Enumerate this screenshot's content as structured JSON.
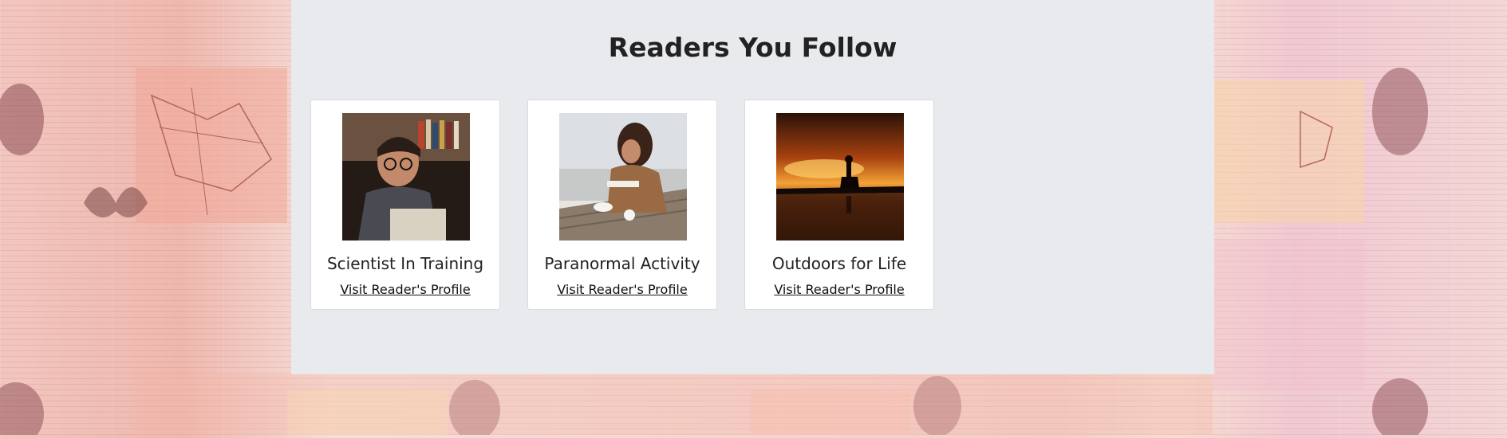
{
  "page": {
    "heading": "Readers You Follow"
  },
  "readers": [
    {
      "name": "Scientist In Training",
      "link_label": "Visit Reader's Profile",
      "photo_icon": "man-reading-book-photo"
    },
    {
      "name": "Paranormal Activity",
      "link_label": "Visit Reader's Profile",
      "photo_icon": "woman-reading-by-sea-photo"
    },
    {
      "name": "Outdoors for Life",
      "link_label": "Visit Reader's Profile",
      "photo_icon": "sunset-silhouette-photo"
    }
  ],
  "colors": {
    "panel_bg": "#e9eaee",
    "card_bg": "#ffffff",
    "text": "#222222"
  }
}
